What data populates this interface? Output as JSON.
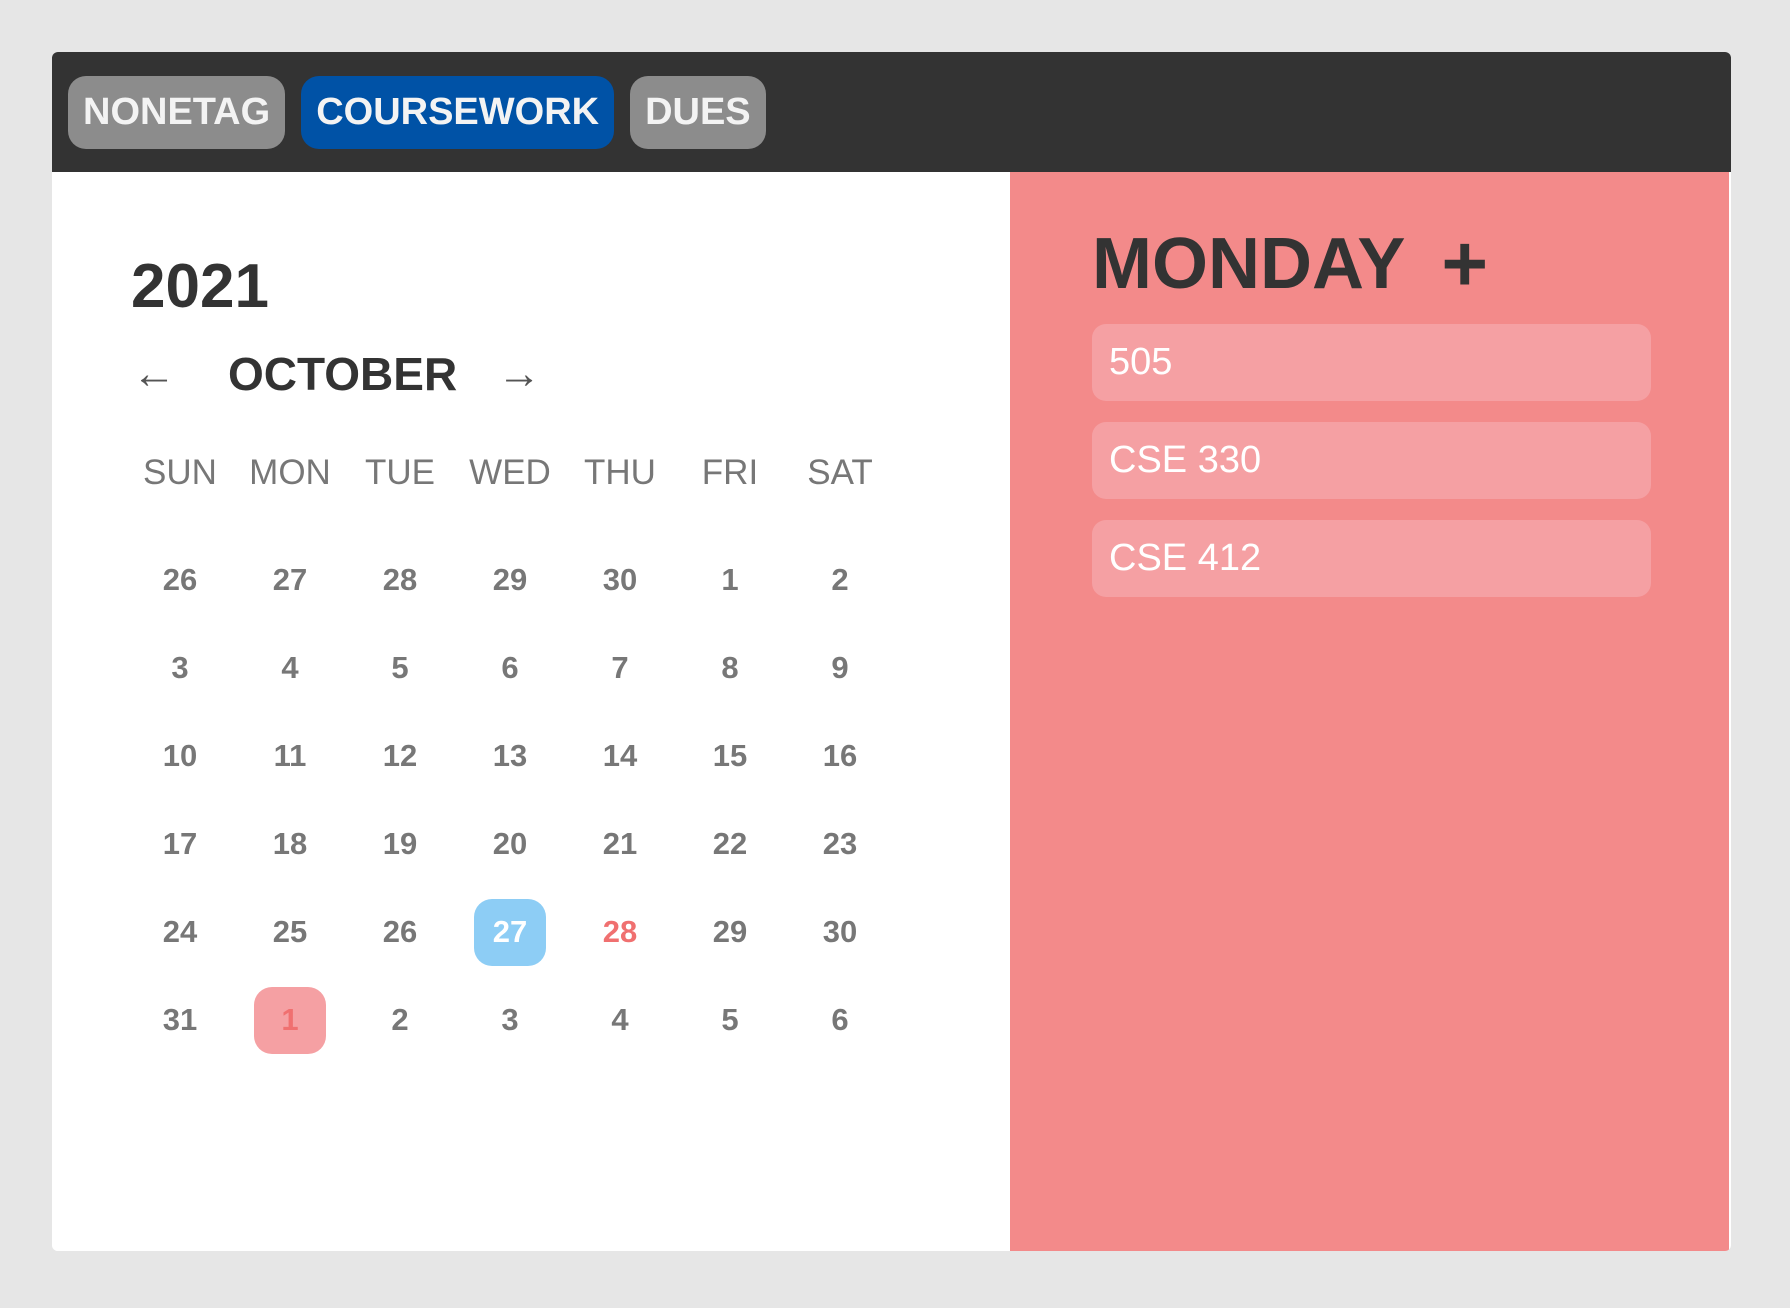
{
  "tags": [
    {
      "label": "NONETAG",
      "active": false
    },
    {
      "label": "COURSEWORK",
      "active": true
    },
    {
      "label": "DUES",
      "active": false
    }
  ],
  "calendar": {
    "year": "2021",
    "month": "OCTOBER",
    "prev_arrow": "←",
    "next_arrow": "→",
    "weekdays": [
      "SUN",
      "MON",
      "TUE",
      "WED",
      "THU",
      "FRI",
      "SAT"
    ],
    "weeks": [
      [
        "26",
        "27",
        "28",
        "29",
        "30",
        "1",
        "2"
      ],
      [
        "3",
        "4",
        "5",
        "6",
        "7",
        "8",
        "9"
      ],
      [
        "10",
        "11",
        "12",
        "13",
        "14",
        "15",
        "16"
      ],
      [
        "17",
        "18",
        "19",
        "20",
        "21",
        "22",
        "23"
      ],
      [
        "24",
        "25",
        "26",
        "27",
        "28",
        "29",
        "30"
      ],
      [
        "31",
        "1",
        "2",
        "3",
        "4",
        "5",
        "6"
      ]
    ],
    "today": "27",
    "event_day": "28",
    "selected_day": "1"
  },
  "panel": {
    "weekday": "MONDAY",
    "add_symbol": "+",
    "events": [
      "505",
      "CSE 330",
      "CSE 412"
    ]
  },
  "colors": {
    "tag_active": "#0052a6",
    "tag_inactive": "#8c8c8c",
    "panel_bg": "#f38a8a",
    "today_bg": "#8dcdf5",
    "selected_bg": "#f5a0a3"
  }
}
